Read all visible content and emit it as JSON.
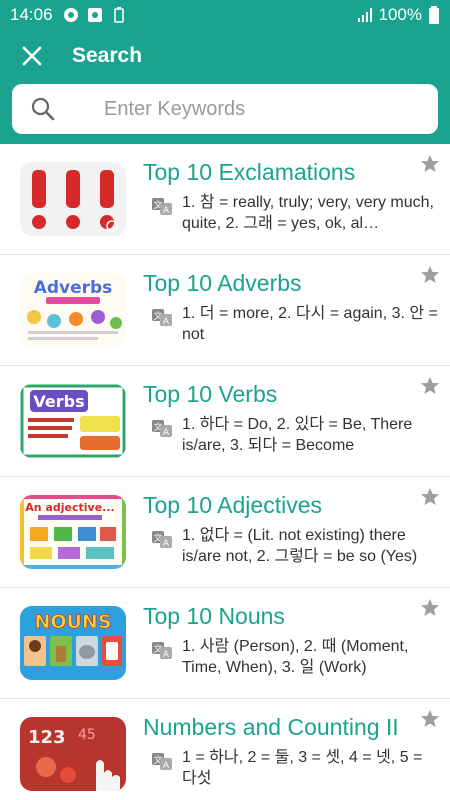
{
  "status_bar": {
    "time": "14:06",
    "battery": "100%"
  },
  "header": {
    "title": "Search",
    "search_placeholder": "Enter Keywords"
  },
  "items": [
    {
      "title": "Top 10 Exclamations",
      "desc": "1. 참 = really, truly; very, very much, quite, 2. 그래 = yes, ok, al…",
      "thumb": "exclamation-marks-image"
    },
    {
      "title": "Top 10 Adverbs",
      "desc": "1. 더 = more, 2. 다시 = again, 3. 안 = not",
      "thumb": "adverbs-image",
      "thumb_text": "Adverbs"
    },
    {
      "title": "Top 10 Verbs",
      "desc": "1. 하다 = Do, 2. 있다 = Be, There is/are, 3. 되다 = Become",
      "thumb": "verbs-image",
      "thumb_text": "Verbs"
    },
    {
      "title": "Top 10 Adjectives",
      "desc": "1. 없다 = (Lit. not existing) there is/are not, 2. 그렇다 = be so (Yes)",
      "thumb": "adjectives-image",
      "thumb_text": "An adjective..."
    },
    {
      "title": "Top 10 Nouns",
      "desc": "1. 사람 (Person), 2. 때 (Moment, Time, When), 3. 일 (Work)",
      "thumb": "nouns-image",
      "thumb_text": "NOUNS"
    },
    {
      "title": "Numbers and Counting II",
      "desc": "1 = 하나, 2 = 둘, 3 = 셋, 4 = 넷, 5 = 다섯",
      "thumb": "numbers-image"
    }
  ]
}
